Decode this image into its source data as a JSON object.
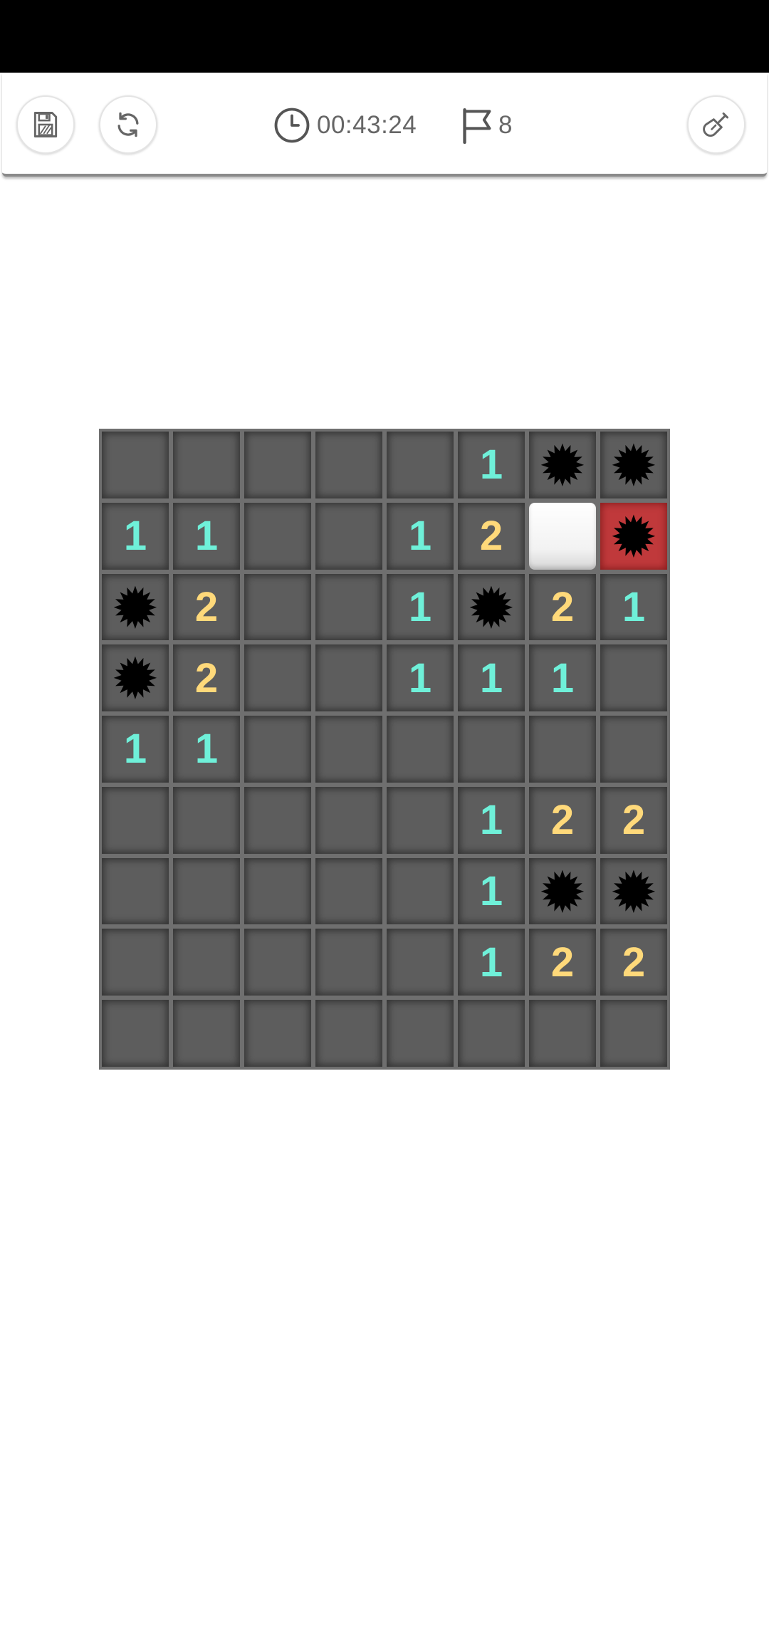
{
  "toolbar": {
    "timer": "00:43:24",
    "flags_remaining": "8",
    "icons": {
      "save": "floppy-disk-icon",
      "restart": "refresh-icon",
      "timer": "clock-icon",
      "flag": "flag-icon",
      "tool": "shovel-icon"
    }
  },
  "board": {
    "rows": 9,
    "cols": 8,
    "colors": {
      "one": "#6ff0d9",
      "two": "#ffd97a",
      "exploded": "#c0393b"
    },
    "cells": [
      [
        "",
        "",
        "",
        "",
        "",
        "1",
        "mine",
        "mine"
      ],
      [
        "1",
        "1",
        "",
        "",
        "1",
        "2",
        "blank",
        "mine-exploded"
      ],
      [
        "mine",
        "2",
        "",
        "",
        "1",
        "mine",
        "2",
        "1"
      ],
      [
        "mine",
        "2",
        "",
        "",
        "1",
        "1",
        "1",
        ""
      ],
      [
        "1",
        "1",
        "",
        "",
        "",
        "",
        "",
        ""
      ],
      [
        "",
        "",
        "",
        "",
        "",
        "1",
        "2",
        "2"
      ],
      [
        "",
        "",
        "",
        "",
        "",
        "1",
        "mine",
        "mine"
      ],
      [
        "",
        "",
        "",
        "",
        "",
        "1",
        "2",
        "2"
      ],
      [
        "",
        "",
        "",
        "",
        "",
        "",
        "",
        ""
      ]
    ]
  }
}
